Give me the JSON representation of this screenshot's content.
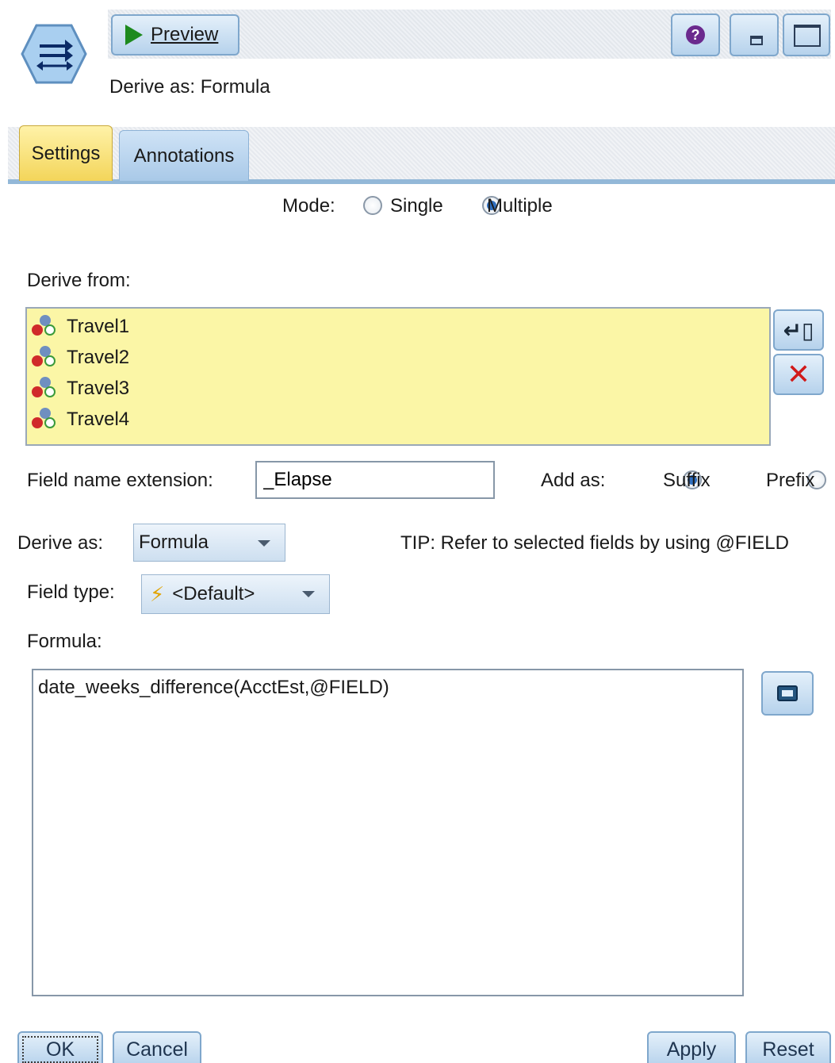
{
  "header": {
    "node_icon": "derive-node-icon",
    "preview_label": "Preview",
    "derive_summary": "Derive as: Formula",
    "help_icon": "help-icon",
    "minimize_icon": "minimize-icon",
    "maximize_icon": "maximize-icon"
  },
  "tabs": [
    {
      "label": "Settings",
      "active": true
    },
    {
      "label": "Annotations",
      "active": false
    }
  ],
  "mode": {
    "label": "Mode:",
    "options": [
      {
        "label": "Single",
        "selected": false
      },
      {
        "label": "Multiple",
        "selected": true
      }
    ]
  },
  "derive_from": {
    "label": "Derive from:",
    "fields": [
      "Travel1",
      "Travel2",
      "Travel3",
      "Travel4"
    ],
    "background_color": "#fbf6a6"
  },
  "extension": {
    "label": "Field name extension:",
    "value": "_Elapse",
    "add_as_label": "Add as:",
    "options": [
      {
        "label": "Suffix",
        "selected": true
      },
      {
        "label": "Prefix",
        "selected": false
      }
    ]
  },
  "derive_as": {
    "label": "Derive as:",
    "value": "Formula",
    "tip": "TIP: Refer to selected fields by using @FIELD"
  },
  "field_type": {
    "label": "Field type:",
    "value": "<Default>"
  },
  "formula": {
    "label": "Formula:",
    "value": "date_weeks_difference(AcctEst,@FIELD)"
  },
  "footer": {
    "ok": "OK",
    "cancel": "Cancel",
    "apply": "Apply",
    "reset": "Reset"
  }
}
